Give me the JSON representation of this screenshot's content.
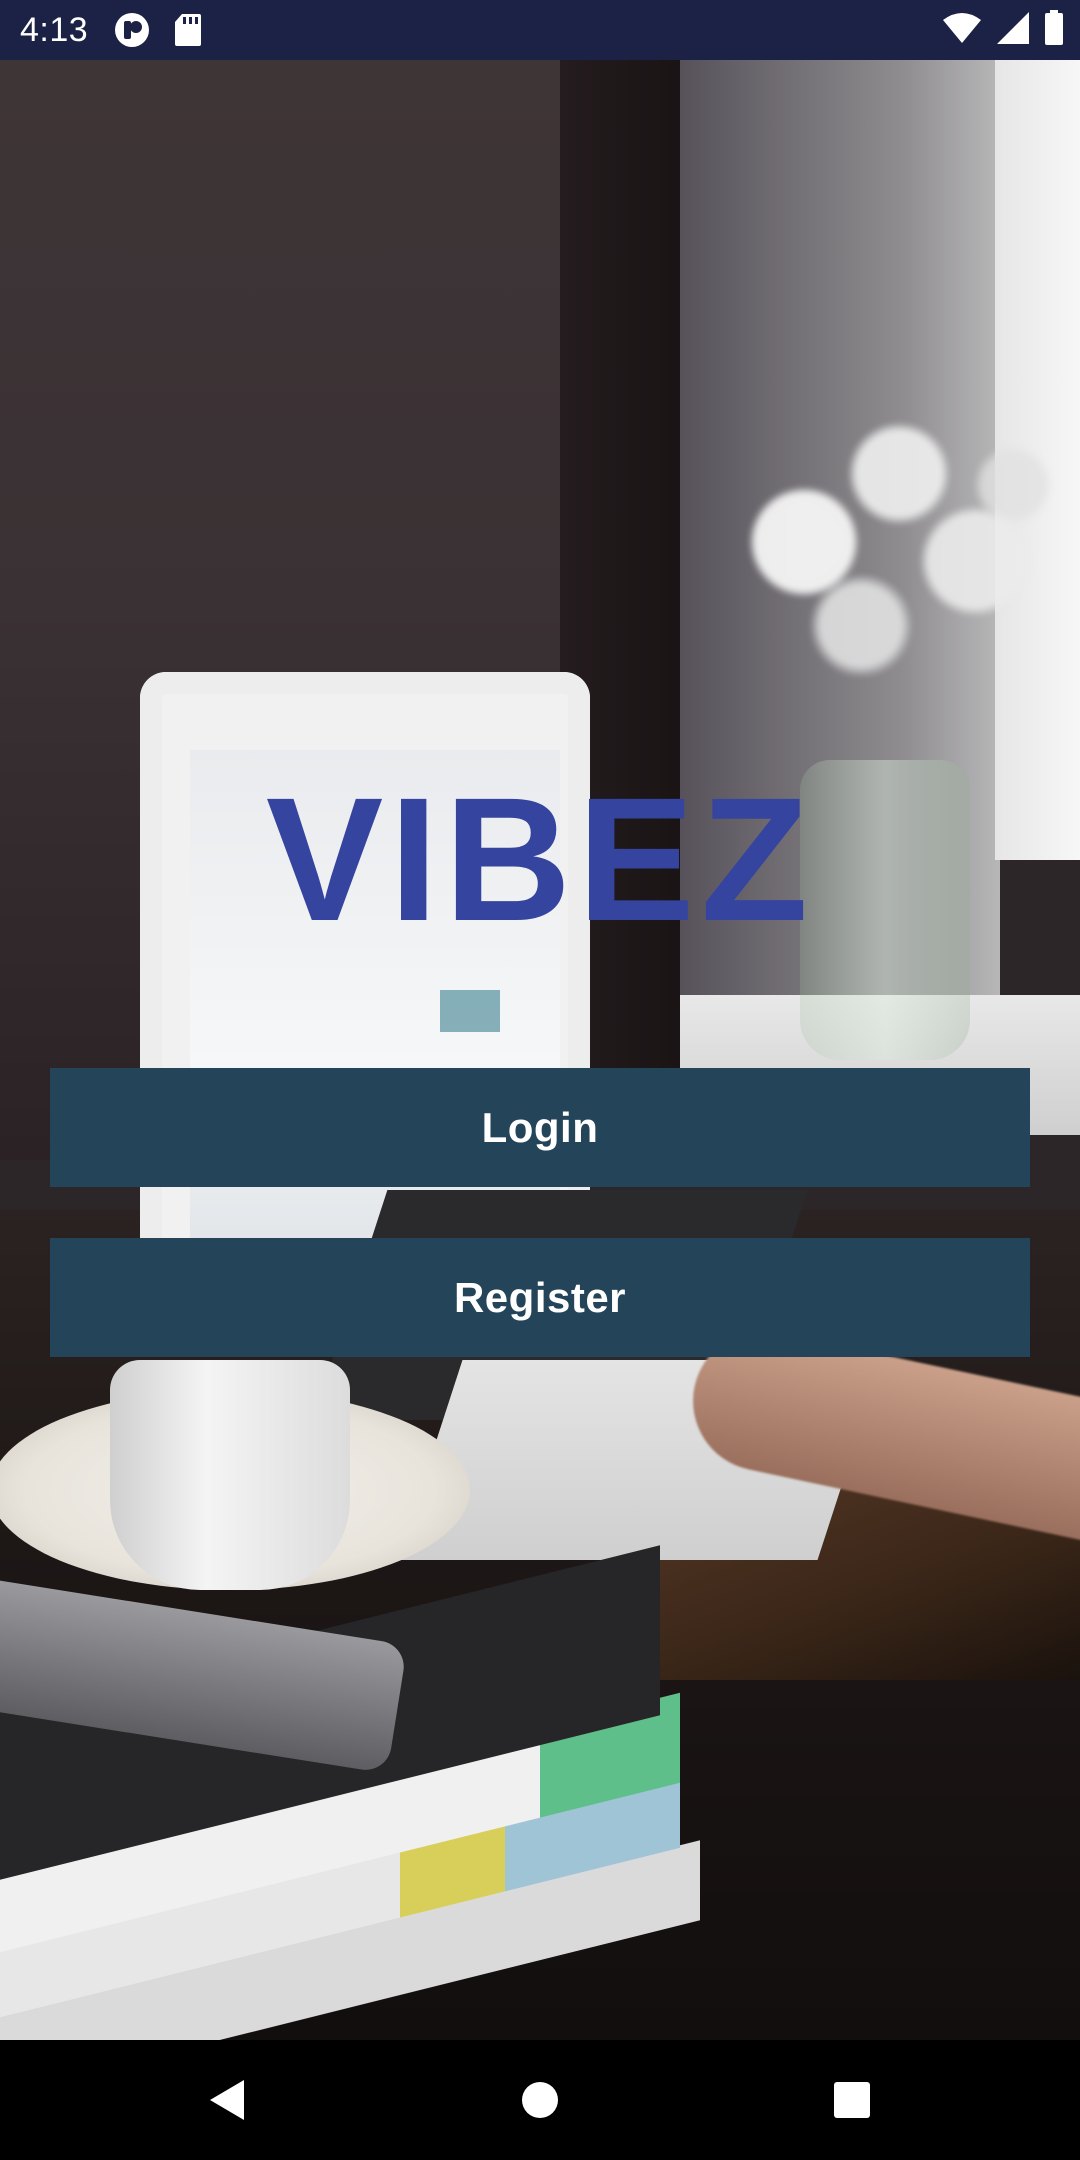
{
  "status_bar": {
    "time": "4:13",
    "icons": [
      "notification-app-icon",
      "sd-card-icon",
      "wifi-icon",
      "cellular-signal-icon",
      "battery-icon"
    ],
    "background_color": "#1c2146"
  },
  "app": {
    "logo_text": "VIBEZ",
    "logo_color": "#35449e",
    "background_image": "desk-with-laptop-coffee-books-photo"
  },
  "buttons": {
    "login_label": "Login",
    "register_label": "Register",
    "button_color": "#244459",
    "label_color": "#ffffff"
  },
  "nav_bar": {
    "icons": [
      "back-icon",
      "home-icon",
      "recents-icon"
    ]
  }
}
